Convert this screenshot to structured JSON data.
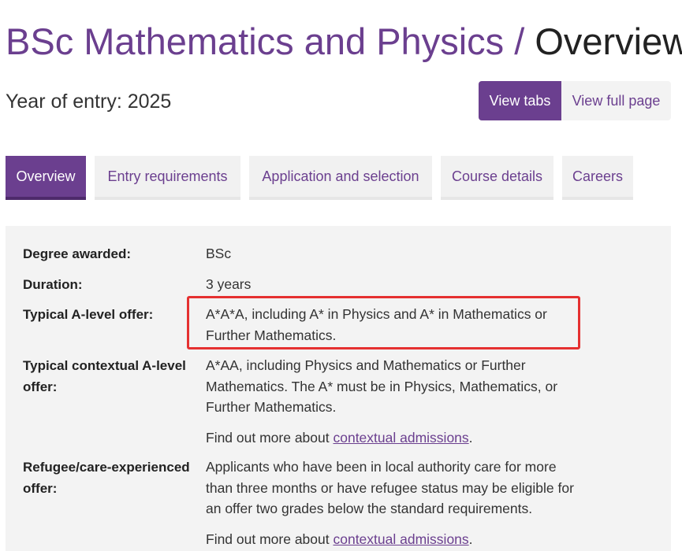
{
  "header": {
    "course_title": "BSc Mathematics and Physics",
    "separator": "/",
    "section_title": "Overview",
    "year_of_entry": "Year of entry: 2025"
  },
  "view_toggle": {
    "view_tabs": "View tabs",
    "view_full_page": "View full page"
  },
  "tabs": [
    {
      "label": "Overview",
      "active": true
    },
    {
      "label": "Entry requirements",
      "active": false
    },
    {
      "label": "Application and selection",
      "active": false
    },
    {
      "label": "Course details",
      "active": false
    },
    {
      "label": "Careers",
      "active": false
    }
  ],
  "overview": {
    "degree": {
      "label": "Degree awarded:",
      "value": "BSc"
    },
    "duration": {
      "label": "Duration:",
      "value": "3 years"
    },
    "a_level": {
      "label": "Typical A-level offer:",
      "value": "A*A*A, including A* in Physics and A* in Mathematics or Further Mathematics."
    },
    "contextual": {
      "label": "Typical contextual A-level offer:",
      "value": "A*AA, including Physics and Mathematics or Further Mathematics. The A* must be in Physics, Mathematics, or Further Mathematics.",
      "more_prefix": "Find out more about ",
      "link": "contextual admissions",
      "more_suffix": "."
    },
    "refugee": {
      "label": "Refugee/care-experienced offer:",
      "value": "Applicants who have been in local authority care for more than three months or have refugee status may be eligible for an offer two grades below the standard requirements.",
      "more_prefix": "Find out more about ",
      "link": "contextual admissions",
      "more_suffix": "."
    }
  },
  "colors": {
    "brand_purple": "#6b3f8f",
    "panel_background": "#f3f3f3",
    "highlight_red": "#e53030"
  }
}
